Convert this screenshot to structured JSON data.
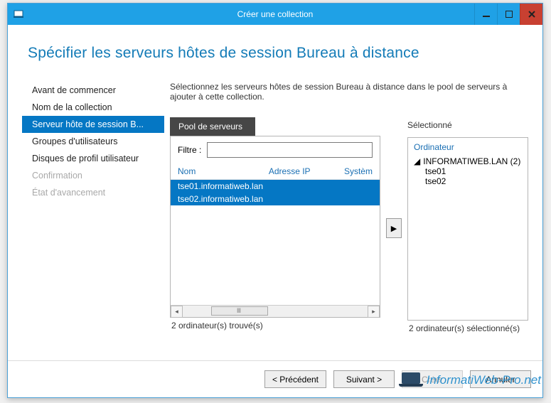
{
  "window": {
    "title": "Créer une collection"
  },
  "heading": "Spécifier les serveurs hôtes de session Bureau à distance",
  "nav": {
    "items": [
      {
        "label": "Avant de commencer",
        "state": "normal"
      },
      {
        "label": "Nom de la collection",
        "state": "normal"
      },
      {
        "label": "Serveur hôte de session B...",
        "state": "active"
      },
      {
        "label": "Groupes d'utilisateurs",
        "state": "normal"
      },
      {
        "label": "Disques de profil utilisateur",
        "state": "normal"
      },
      {
        "label": "Confirmation",
        "state": "disabled"
      },
      {
        "label": "État d'avancement",
        "state": "disabled"
      }
    ]
  },
  "instruction": "Sélectionnez les serveurs hôtes de session Bureau à distance dans le pool de serveurs à ajouter à cette collection.",
  "pool": {
    "tab": "Pool de serveurs",
    "filter_label": "Filtre :",
    "filter_value": "",
    "columns": {
      "name": "Nom",
      "ip": "Adresse IP",
      "os": "Systèm"
    },
    "rows": [
      {
        "name": "tse01.informatiweb.lan"
      },
      {
        "name": "tse02.informatiweb.lan"
      }
    ],
    "found": "2 ordinateur(s) trouvé(s)"
  },
  "selected": {
    "label": "Sélectionné",
    "column": "Ordinateur",
    "root": "INFORMATIWEB.LAN (2)",
    "items": [
      "tse01",
      "tse02"
    ],
    "count": "2 ordinateur(s) sélectionné(s)"
  },
  "footer": {
    "prev": "< Précédent",
    "next": "Suivant >",
    "create": "Créer",
    "cancel": "Annuler"
  },
  "watermark": "InformatiWeb-Pro.net"
}
